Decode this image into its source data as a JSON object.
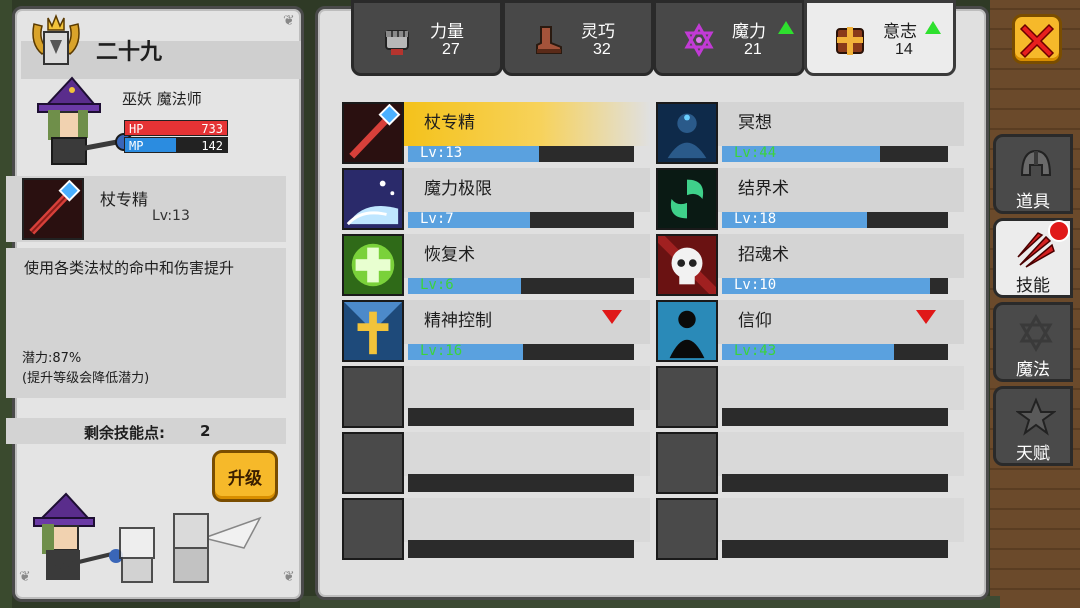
{
  "character": {
    "name": "二十九",
    "class": "巫妖  魔法师",
    "hp": {
      "label": "HP",
      "value": "733"
    },
    "mp": {
      "label": "MP",
      "value": "142",
      "fill": 0.5
    }
  },
  "selected_skill": {
    "name": "杖专精",
    "level": "Lv:13",
    "description": "使用各类法杖的命中和伤害提升",
    "potential": "潜力:87%",
    "potential_hint": "(提升等级会降低潜力)"
  },
  "remaining_points": {
    "label": "剩余技能点:",
    "value": "2"
  },
  "upgrade_label": "升级",
  "attributes": [
    {
      "name": "力量",
      "value": "27",
      "icon": "fist-icon",
      "up": false
    },
    {
      "name": "灵巧",
      "value": "32",
      "icon": "boot-icon",
      "up": false
    },
    {
      "name": "魔力",
      "value": "21",
      "icon": "hexagram-icon",
      "up": true
    },
    {
      "name": "意志",
      "value": "14",
      "icon": "shield-cross-icon",
      "up": true
    }
  ],
  "skills_left": [
    {
      "name": "杖专精",
      "level": "Lv:13",
      "progress": 0.58,
      "green": false,
      "selected": true,
      "down": false
    },
    {
      "name": "魔力极限",
      "level": "Lv:7",
      "progress": 0.54,
      "green": false,
      "selected": false,
      "down": false
    },
    {
      "name": "恢复术",
      "level": "Lv:6",
      "progress": 0.5,
      "green": true,
      "selected": false,
      "down": false
    },
    {
      "name": "精神控制",
      "level": "Lv:16",
      "progress": 0.51,
      "green": true,
      "selected": false,
      "down": true
    }
  ],
  "skills_right": [
    {
      "name": "冥想",
      "level": "Lv:44",
      "progress": 0.7,
      "green": true,
      "selected": false,
      "down": false
    },
    {
      "name": "结界术",
      "level": "Lv:18",
      "progress": 0.64,
      "green": false,
      "selected": false,
      "down": false
    },
    {
      "name": "招魂术",
      "level": "Lv:10",
      "progress": 0.92,
      "green": false,
      "selected": false,
      "down": false
    },
    {
      "name": "信仰",
      "level": "Lv:43",
      "progress": 0.76,
      "green": true,
      "selected": false,
      "down": true
    }
  ],
  "side_tabs": [
    {
      "label": "道具",
      "icon": "helmet-icon",
      "active": false
    },
    {
      "label": "技能",
      "icon": "red-claw-icon",
      "active": true
    },
    {
      "label": "魔法",
      "icon": "hexagram-icon",
      "active": false
    },
    {
      "label": "天赋",
      "icon": "star-icon",
      "active": false
    }
  ],
  "colors": {
    "hp": "#e53335",
    "mp": "#2b8ce0",
    "level_bar": "#5aa1df",
    "selected_row": "#f4c21b",
    "upgrade_button": "#f6b92a",
    "up_arrow": "#2ee02e",
    "down_arrow": "#e01818"
  }
}
